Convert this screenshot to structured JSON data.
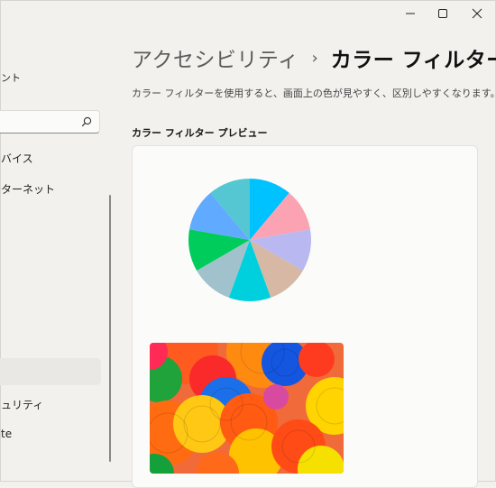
{
  "window": {
    "controls": [
      "minimize",
      "maximize",
      "close"
    ]
  },
  "sidebar": {
    "account_text": "ント",
    "search": {
      "placeholder": "",
      "icon": "search-icon"
    },
    "items": [
      {
        "label": "バイス",
        "key": "devices"
      },
      {
        "label": "ターネット",
        "key": "network"
      },
      {
        "label": "ュリティ",
        "key": "accessibility"
      },
      {
        "label": "te",
        "key": "update"
      }
    ]
  },
  "main": {
    "breadcrumb": {
      "parent": "アクセシビリティ",
      "separator": "›",
      "current": "カラー フィルター"
    },
    "description": "カラー フィルターを使用すると、画面上の色が見やすく、区別しやすくなります。",
    "preview": {
      "label": "カラー フィルター プレビュー",
      "pie_colors": [
        "#00c2ff",
        "#fba3b3",
        "#b9b8f0",
        "#d6b8a5",
        "#00d0dd",
        "#a1c2cc",
        "#00cc5c",
        "#60aaff",
        "#54c7d2"
      ]
    }
  },
  "colors": {
    "background": "#f3f1ee",
    "card": "#fbfbf9"
  }
}
